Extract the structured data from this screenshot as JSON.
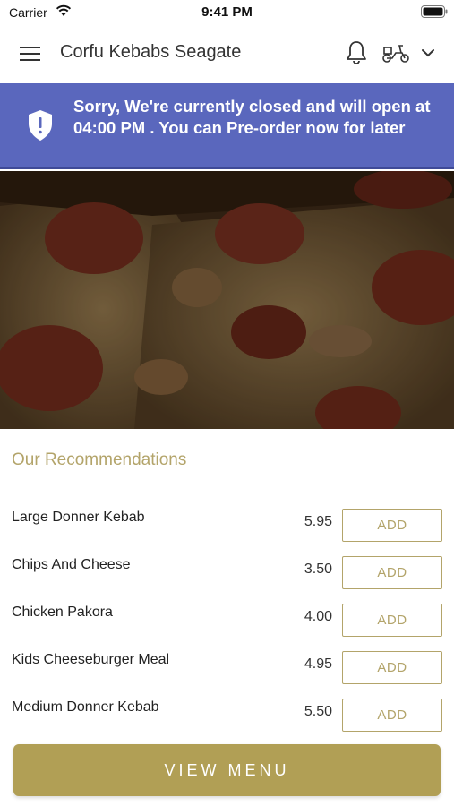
{
  "status_bar": {
    "carrier": "Carrier",
    "time": "9:41 PM",
    "icons": [
      "wifi-icon",
      "battery-icon"
    ]
  },
  "header": {
    "store_name": "Corfu Kebabs Seagate",
    "icons": [
      "menu-icon",
      "bell-icon",
      "scooter-icon",
      "chevron-down-icon"
    ]
  },
  "banner": {
    "message": "Sorry, We're currently closed and will open at 04:00 PM . You can Pre-order now for later",
    "icon": "shield-icon",
    "background_color": "#5a67bd"
  },
  "hero": {
    "image": "pepperoni-pizza-photo"
  },
  "recommendations": {
    "title": "Our Recommendations",
    "items": [
      {
        "name": "Large Donner Kebab",
        "price": "5.95",
        "button": "ADD"
      },
      {
        "name": "Chips And Cheese",
        "price": "3.50",
        "button": "ADD"
      },
      {
        "name": "Chicken Pakora",
        "price": "4.00",
        "button": "ADD"
      },
      {
        "name": "Kids Cheeseburger Meal",
        "price": "4.95",
        "button": "ADD"
      },
      {
        "name": "Medium Donner Kebab",
        "price": "5.50",
        "button": "ADD"
      }
    ]
  },
  "footer": {
    "view_menu_label": "VIEW MENU"
  },
  "colors": {
    "accent": "#b19f55",
    "banner": "#5a67bd"
  }
}
